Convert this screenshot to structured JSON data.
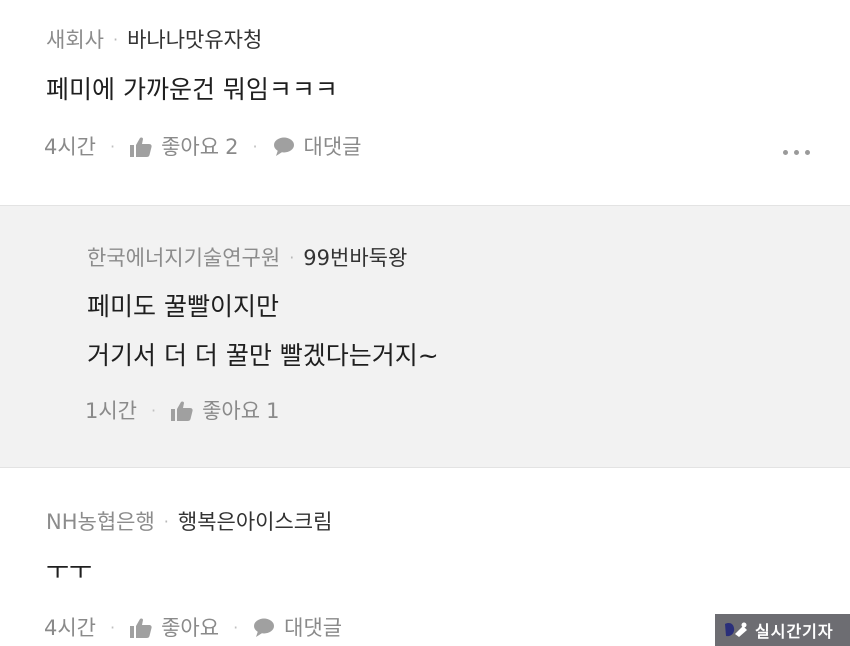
{
  "comments": [
    {
      "company": "새회사",
      "nickname": "바나나맛유자청",
      "text": "페미에 가까운건 뭐임ㅋㅋㅋ",
      "time": "4시간",
      "like_label": "좋아요",
      "like_count": "2",
      "reply_label": "대댓글"
    },
    {
      "company": "한국에너지기술연구원",
      "nickname": "99번바둑왕",
      "text_line1": "페미도 꿀빨이지만",
      "text_line2": "거기서 더 더 꿀만 빨겠다는거지~",
      "time": "1시간",
      "like_label": "좋아요",
      "like_count": "1"
    },
    {
      "company": "NH농협은행",
      "nickname": "행복은아이스크림",
      "text": "ㅜㅜ",
      "time": "4시간",
      "like_label": "좋아요",
      "reply_label": "대댓글"
    }
  ],
  "separator": "·",
  "watermark": "실시간기자",
  "icons": {
    "like": "thumbs-up-icon",
    "reply": "speech-bubble-icon",
    "more": "more-dots-icon"
  },
  "colors": {
    "reply_background": "#f2f2f2",
    "meta_gray": "#8c8c8c",
    "watermark_bg": "#6d6d72"
  }
}
